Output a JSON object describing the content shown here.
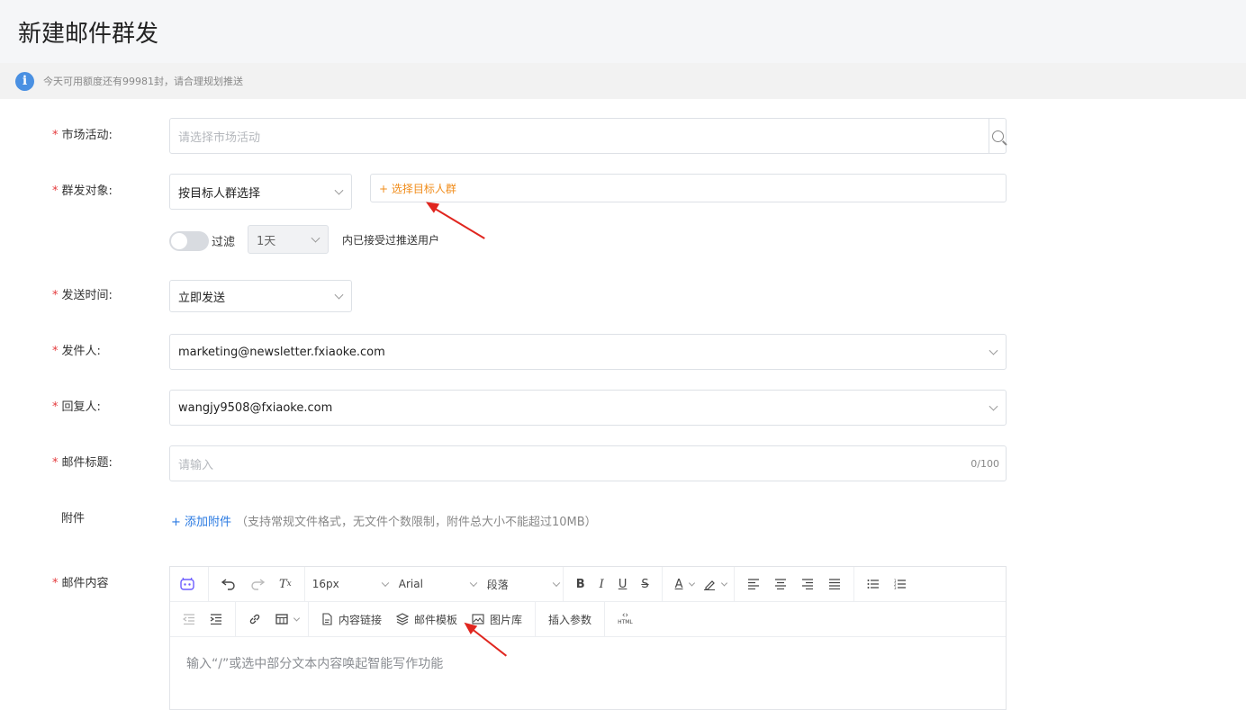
{
  "page": {
    "title": "新建邮件群发"
  },
  "notice": {
    "text": "今天可用额度还有99981封，请合理规划推送"
  },
  "form": {
    "campaign": {
      "label": "市场活动:",
      "placeholder": "请选择市场活动"
    },
    "audience": {
      "label": "群发对象:",
      "select_value": "按目标人群选择",
      "add_link": "+ 选择目标人群"
    },
    "filter": {
      "toggle_label": "过滤",
      "period_value": "1天",
      "suffix": "内已接受过推送用户"
    },
    "send_time": {
      "label": "发送时间:",
      "value": "立即发送"
    },
    "sender": {
      "label": "发件人:",
      "value": "marketing@newsletter.fxiaoke.com"
    },
    "reply_to": {
      "label": "回复人:",
      "value": "wangjy9508@fxiaoke.com"
    },
    "subject": {
      "label": "邮件标题:",
      "placeholder": "请输入",
      "counter": "0/100"
    },
    "attachment": {
      "label": "附件",
      "add_link": "+ 添加附件",
      "hint": "（支持常规文件格式，无文件个数限制，附件总大小不能超过10MB）"
    },
    "content": {
      "label": "邮件内容",
      "placeholder": "输入“/”或选中部分文本内容唤起智能写作功能"
    }
  },
  "editor": {
    "font_size": "16px",
    "font_family": "Arial",
    "block_format": "段落",
    "content_link": "内容链接",
    "mail_template": "邮件模板",
    "image_library": "图片库",
    "insert_param": "插入参数",
    "html_label": "HTML"
  },
  "colors": {
    "required": "#e4393c",
    "link": "#2a7ae2",
    "accent": "#f08c1a",
    "annotation": "#e0261f"
  }
}
